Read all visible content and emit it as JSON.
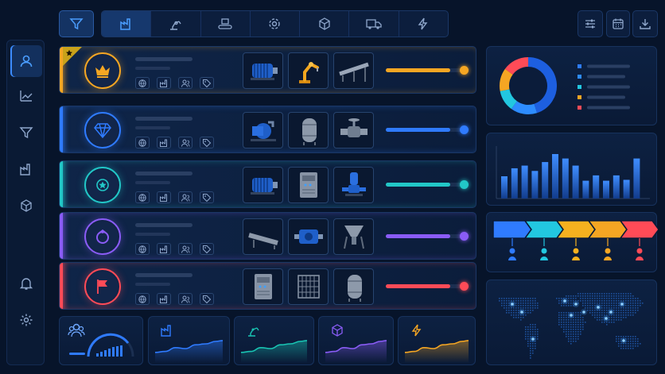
{
  "sidebar": {
    "items": [
      {
        "icon": "user-icon",
        "active": true
      },
      {
        "icon": "trend-icon",
        "active": false
      },
      {
        "icon": "filter-icon",
        "active": false
      },
      {
        "icon": "factory-icon",
        "active": false
      },
      {
        "icon": "cube-icon",
        "active": false
      }
    ],
    "bottom": [
      {
        "icon": "bell-icon"
      },
      {
        "icon": "gear-icon"
      }
    ]
  },
  "toolbar": {
    "filter_icon": "filter-icon",
    "tabs": [
      "factory-icon",
      "robot-arm-icon",
      "conveyor-icon",
      "gear-icon",
      "box-icon",
      "truck-icon",
      "lightning-icon"
    ],
    "actions": [
      "sliders-icon",
      "calendar-icon",
      "download-icon"
    ]
  },
  "rows": [
    {
      "tier_icon": "crown-icon",
      "color": "#f5a623",
      "progress": 0.85,
      "starred": true,
      "thumbs": [
        "motor-icon",
        "robot-arm-icon",
        "conveyor-icon"
      ]
    },
    {
      "tier_icon": "diamond-icon",
      "color": "#2f7bff",
      "progress": 0.85,
      "starred": false,
      "thumbs": [
        "pump-icon",
        "tank-icon",
        "valve-icon"
      ]
    },
    {
      "tier_icon": "medal-icon",
      "color": "#22c7c7",
      "progress": 0.85,
      "starred": false,
      "thumbs": [
        "motor-icon",
        "control-cabinet-icon",
        "vertical-pump-icon"
      ]
    },
    {
      "tier_icon": "ring-icon",
      "color": "#8a5cf6",
      "progress": 0.85,
      "starred": false,
      "thumbs": [
        "roller-conveyor-icon",
        "gearbox-icon",
        "hopper-icon"
      ]
    },
    {
      "tier_icon": "flag-icon",
      "color": "#ff4b57",
      "progress": 0.85,
      "starred": false,
      "thumbs": [
        "control-cabinet-icon",
        "cage-icon",
        "tank-icon"
      ]
    }
  ],
  "bottom_cards": [
    {
      "icon": "people-icon",
      "color": "#3a8cff"
    },
    {
      "icon": "factory-icon",
      "color": "#2f7bff"
    },
    {
      "icon": "robot-arm-icon",
      "color": "#19c4b3"
    },
    {
      "icon": "box-icon",
      "color": "#8a5cf6"
    },
    {
      "icon": "lightning-icon",
      "color": "#f5a623"
    }
  ],
  "donut": {
    "slices": [
      {
        "value": 0.45,
        "color": "#1d5fe0"
      },
      {
        "value": 0.15,
        "color": "#2d8cff"
      },
      {
        "value": 0.12,
        "color": "#22c7e0"
      },
      {
        "value": 0.13,
        "color": "#f5a623"
      },
      {
        "value": 0.15,
        "color": "#ff4b57"
      }
    ],
    "legend_colors": [
      "#2d7cff",
      "#2d8cff",
      "#22c7e0",
      "#f5a623",
      "#ff4b57"
    ]
  },
  "bar_chart": {
    "values": [
      0.5,
      0.68,
      0.74,
      0.62,
      0.82,
      1.0,
      0.9,
      0.74,
      0.4,
      0.52,
      0.4,
      0.52,
      0.42,
      0.9
    ]
  },
  "process_flow": {
    "steps": [
      {
        "color": "#2f7bff"
      },
      {
        "color": "#22c7e0"
      },
      {
        "color": "#f5b11f"
      },
      {
        "color": "#f5a623"
      },
      {
        "color": "#ff4b57"
      }
    ]
  },
  "map": {
    "icon": "world-map"
  }
}
